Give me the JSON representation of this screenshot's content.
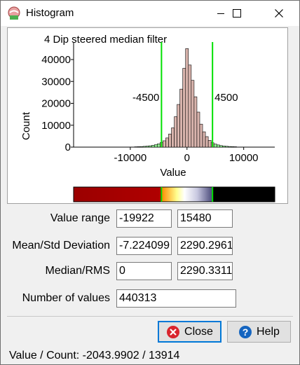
{
  "window": {
    "title": "Histogram"
  },
  "chart_data": {
    "type": "bar",
    "title": "4 Dip steered median filter",
    "xlabel": "Value",
    "ylabel": "Count",
    "xlim": [
      -20000,
      15480
    ],
    "ylim": [
      0,
      48000
    ],
    "xticks": [
      -10000,
      0,
      10000
    ],
    "xtick_labels": [
      "-10000",
      "0",
      "10000"
    ],
    "yticks": [
      0,
      10000,
      20000,
      30000,
      40000
    ],
    "ytick_labels": [
      "0",
      "10000",
      "20000",
      "30000",
      "40000"
    ],
    "clip_markers": [
      {
        "value": -4500,
        "label": "-4500",
        "color": "#00e000"
      },
      {
        "value": 4500,
        "label": "4500",
        "color": "#00e000"
      }
    ],
    "bin_width": 500,
    "bins": [
      {
        "x": -9000,
        "count": 150
      },
      {
        "x": -8500,
        "count": 200
      },
      {
        "x": -8000,
        "count": 250
      },
      {
        "x": -7500,
        "count": 350
      },
      {
        "x": -7000,
        "count": 450
      },
      {
        "x": -6500,
        "count": 600
      },
      {
        "x": -6000,
        "count": 800
      },
      {
        "x": -5500,
        "count": 1100
      },
      {
        "x": -5000,
        "count": 1500
      },
      {
        "x": -4500,
        "count": 2100
      },
      {
        "x": -4000,
        "count": 2900
      },
      {
        "x": -3500,
        "count": 4200
      },
      {
        "x": -3000,
        "count": 6000
      },
      {
        "x": -2500,
        "count": 8800
      },
      {
        "x": -2000,
        "count": 13900
      },
      {
        "x": -1500,
        "count": 19500
      },
      {
        "x": -1000,
        "count": 26500
      },
      {
        "x": -500,
        "count": 36000
      },
      {
        "x": 0,
        "count": 45000
      },
      {
        "x": 500,
        "count": 37500
      },
      {
        "x": 1000,
        "count": 30500
      },
      {
        "x": 1500,
        "count": 23000
      },
      {
        "x": 2000,
        "count": 16000
      },
      {
        "x": 2500,
        "count": 10500
      },
      {
        "x": 3000,
        "count": 7000
      },
      {
        "x": 3500,
        "count": 4800
      },
      {
        "x": 4000,
        "count": 3100
      },
      {
        "x": 4500,
        "count": 2000
      },
      {
        "x": 5000,
        "count": 1400
      },
      {
        "x": 5500,
        "count": 1000
      },
      {
        "x": 6000,
        "count": 700
      },
      {
        "x": 6500,
        "count": 500
      },
      {
        "x": 7000,
        "count": 380
      },
      {
        "x": 7500,
        "count": 280
      },
      {
        "x": 8000,
        "count": 220
      },
      {
        "x": 8500,
        "count": 170
      }
    ],
    "bar_fill": "#d9b4ad",
    "bar_fill_clipped": "#90ee90",
    "bar_stroke": "#000000"
  },
  "colorbar": {
    "clip_low": -4500,
    "clip_high": 4500,
    "stops": [
      "#9b0000",
      "#b00000",
      "#ff8c00",
      "#ffff90",
      "#ffffff",
      "#c8c8e0",
      "#4a4a7a",
      "#000000"
    ]
  },
  "form": {
    "value_range_label": "Value range",
    "value_range_min": "-19922",
    "value_range_max": "15480",
    "mean_std_label": "Mean/Std Deviation",
    "mean": "-7.224099",
    "std": "2290.2961",
    "median_rms_label": "Median/RMS",
    "median": "0",
    "rms": "2290.3311",
    "num_values_label": "Number of values",
    "num_values": "440313"
  },
  "buttons": {
    "close_label": "Close",
    "help_label": "Help"
  },
  "status": {
    "text": "Value / Count: -2043.9902 / 13914"
  }
}
